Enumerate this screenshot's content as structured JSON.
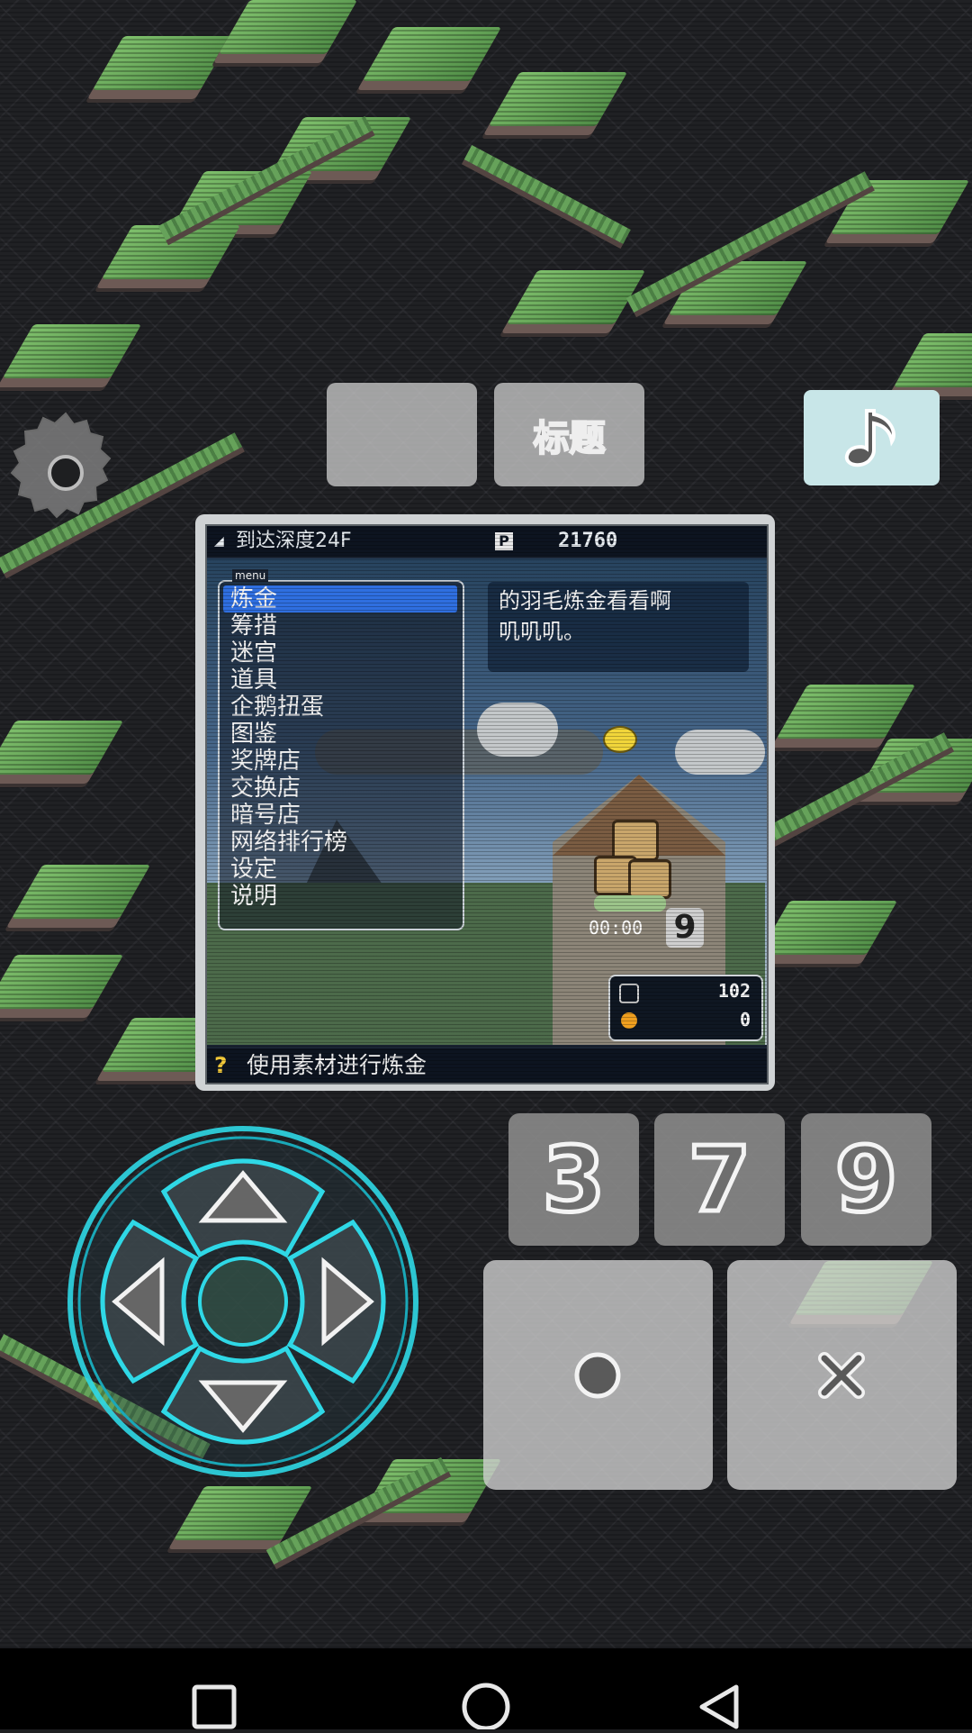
{
  "top_buttons": {
    "blank_label": "",
    "title_label": "标题"
  },
  "music_button": {
    "icon": "music-note-icon"
  },
  "settings": {
    "icon": "gear-icon"
  },
  "game": {
    "depth_label": "到达深度24F",
    "points_icon": "P",
    "points": "21760",
    "menu_tag": "menu",
    "menu_items": [
      "炼金",
      "筹措",
      "迷宫",
      "道具",
      "企鹅扭蛋",
      "图鉴",
      "奖牌店",
      "交换店",
      "暗号店",
      "网络排行榜",
      "设定",
      "说明"
    ],
    "selected_index": 0,
    "message_line1": "的羽毛炼金看看啊",
    "message_line2": "叽叽叽。",
    "timer": "00:00",
    "chest_count": "9",
    "stat1": "102",
    "stat2": "0",
    "help_icon": "?",
    "help_text": "使用素材进行炼金"
  },
  "keys": {
    "k3": "3",
    "k7": "7",
    "k9": "9"
  },
  "action_buttons": {
    "circle": "circle-icon",
    "cross": "cross-icon"
  },
  "colors": {
    "dpad_glow": "#2fd8e6",
    "music_bg": "#c8e6e8",
    "menu_select": "#2f6fe0"
  }
}
